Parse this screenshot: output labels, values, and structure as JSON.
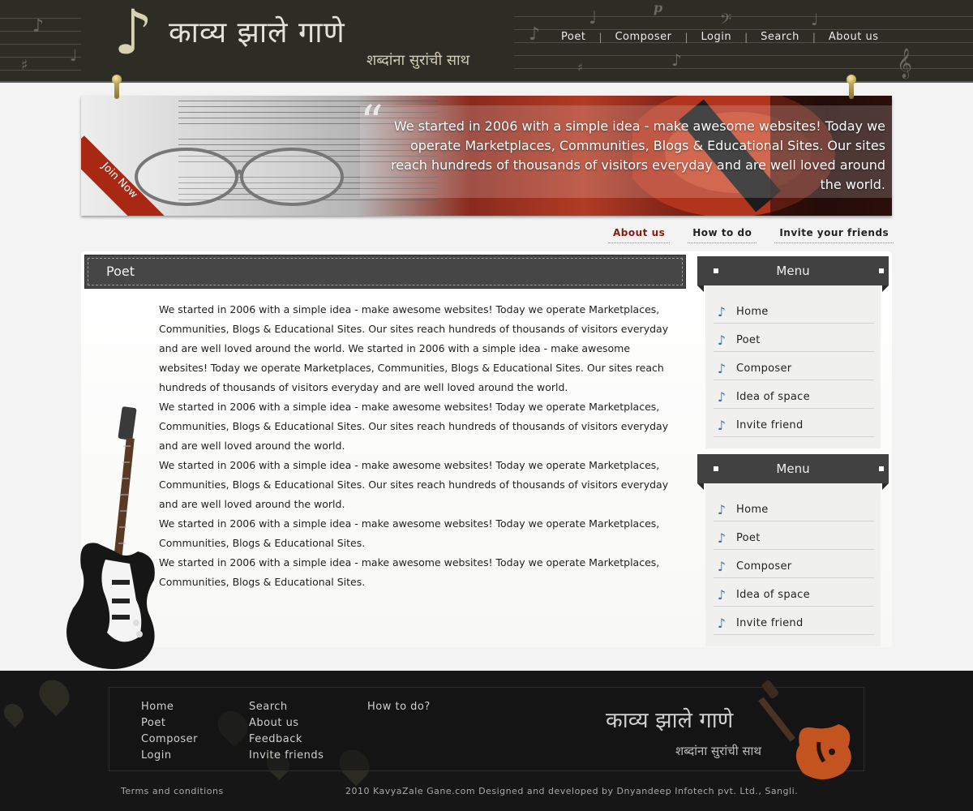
{
  "header": {
    "logo_title": "काव्य झाले गाणे",
    "logo_subtitle": "शब्दांना सुरांची  साथ",
    "nav": [
      "Poet",
      "Composer",
      "Login",
      "Search",
      "About us"
    ]
  },
  "banner": {
    "quote_mark": "“",
    "text": "We started in 2006 with a simple idea - make awesome websites! Today we operate Marketplaces, Communities, Blogs & Educational Sites. Our sites reach hundreds of thousands of visitors everyday and are well loved around the world.",
    "join_label": "Join Now"
  },
  "tabs": [
    "About us",
    "How to do",
    "Invite your friends"
  ],
  "main": {
    "section_title": "Poet",
    "paragraphs": [
      "We started in 2006 with a simple idea - make awesome websites! Today we operate Marketplaces, Communities, Blogs & Educational Sites.  Our sites reach hundreds of thousands of visitors everyday and are well loved around the world. We started in 2006 with a simple idea - make awesome websites! Today we operate Marketplaces, Communities, Blogs & Educational Sites.  Our sites reach hundreds of thousands of visitors everyday and are well loved around the world.",
      "We started in 2006 with a simple idea - make awesome websites! Today we operate Marketplaces, Communities, Blogs & Educational Sites.  Our sites reach hundreds of thousands of visitors everyday and are well loved around the world.",
      "We started in 2006 with a simple idea - make awesome websites! Today we operate Marketplaces, Communities, Blogs & Educational Sites.  Our sites reach hundreds of thousands of visitors everyday and are well loved around the world.",
      "We started in 2006 with a simple idea - make awesome websites! Today we operate Marketplaces, Communities, Blogs & Educational Sites.",
      "We started in 2006 with a simple idea - make awesome websites! Today we operate Marketplaces, Communities, Blogs & Educational Sites."
    ]
  },
  "sidebar": {
    "menus": [
      {
        "title": "Menu",
        "items": [
          "Home",
          "Poet",
          "Composer",
          "Idea of space",
          "Invite friend"
        ]
      },
      {
        "title": "Menu",
        "items": [
          "Home",
          "Poet",
          "Composer",
          "Idea of space",
          "Invite friend"
        ]
      }
    ],
    "item_icon": "music-note-icon"
  },
  "footer": {
    "col1": [
      "Home",
      "Poet",
      "Composer",
      "Login"
    ],
    "col2": [
      "Search",
      "About us",
      "Feedback",
      "Invite friends"
    ],
    "col3": [
      "How to do?"
    ],
    "logo_title": "काव्य झाले गाणे",
    "logo_subtitle": "शब्दांना सुरांची  साथ",
    "terms": "Terms and conditions",
    "copyright": "2010 KavyaZale Gane.com Designed and developed by Dnyandeep Infotech pvt. Ltd., Sangli."
  },
  "colors": {
    "header_bg": "#2d2c25",
    "accent_red": "#8a1a0e",
    "menu_head": "#414141",
    "footer_bg": "#161616"
  }
}
